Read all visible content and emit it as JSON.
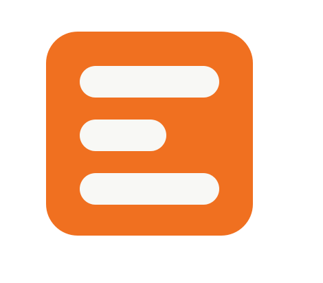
{
  "icon": {
    "name": "menu-lines-icon",
    "background_color": "#F07020",
    "bar_color": "#F8F8F5",
    "bars": [
      {
        "name": "long-bar"
      },
      {
        "name": "short-bar"
      },
      {
        "name": "long-bar"
      }
    ]
  }
}
